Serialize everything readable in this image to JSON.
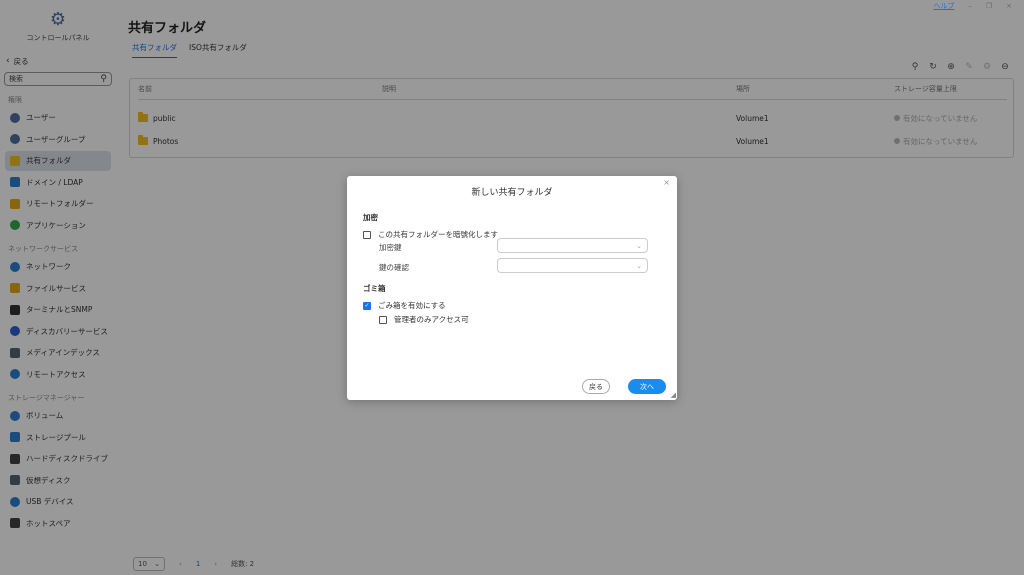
{
  "window": {
    "help": "ヘルプ",
    "minimize": "–",
    "restore": "❐",
    "close": "×"
  },
  "sidebar": {
    "title": "コントロールパネル",
    "back": "戻る",
    "search_placeholder": "検索",
    "sections": [
      {
        "label": "権限",
        "items": [
          {
            "label": "ユーザー",
            "icon": "user-icon",
            "color": "#4d6fa3"
          },
          {
            "label": "ユーザーグループ",
            "icon": "user-group-icon",
            "color": "#4d6fa3"
          },
          {
            "label": "共有フォルダ",
            "icon": "folder-icon",
            "color": "#f0c020",
            "active": true
          },
          {
            "label": "ドメイン / LDAP",
            "icon": "domain-icon",
            "color": "#2d7fd3"
          },
          {
            "label": "リモートフォルダー",
            "icon": "remote-folder-icon",
            "color": "#e6a817"
          },
          {
            "label": "アプリケーション",
            "icon": "application-icon",
            "color": "#34a853"
          }
        ]
      },
      {
        "label": "ネットワークサービス",
        "items": [
          {
            "label": "ネットワーク",
            "icon": "network-icon",
            "color": "#2d7fd3"
          },
          {
            "label": "ファイルサービス",
            "icon": "file-service-icon",
            "color": "#e6a817"
          },
          {
            "label": "ターミナルとSNMP",
            "icon": "terminal-icon",
            "color": "#333333"
          },
          {
            "label": "ディスカバリーサービス",
            "icon": "discovery-icon",
            "color": "#2d5fd3"
          },
          {
            "label": "メディアインデックス",
            "icon": "media-index-icon",
            "color": "#556677"
          },
          {
            "label": "リモートアクセス",
            "icon": "remote-access-icon",
            "color": "#2d7fd3"
          }
        ]
      },
      {
        "label": "ストレージマネージャー",
        "items": [
          {
            "label": "ボリューム",
            "icon": "volume-icon",
            "color": "#2d7fd3"
          },
          {
            "label": "ストレージプール",
            "icon": "storage-pool-icon",
            "color": "#2d7fd3"
          },
          {
            "label": "ハードディスクドライブ",
            "icon": "hdd-icon",
            "color": "#444444"
          },
          {
            "label": "仮想ディスク",
            "icon": "virtual-disk-icon",
            "color": "#556677"
          },
          {
            "label": "USB デバイス",
            "icon": "usb-icon",
            "color": "#2d7fd3"
          },
          {
            "label": "ホットスペア",
            "icon": "hot-spare-icon",
            "color": "#444444"
          }
        ]
      }
    ]
  },
  "main": {
    "title": "共有フォルダ",
    "tabs": [
      {
        "label": "共有フォルダ",
        "active": true
      },
      {
        "label": "ISO共有フォルダ",
        "active": false
      }
    ],
    "toolbar": {
      "search": "⚲",
      "refresh": "↻",
      "add": "⊕",
      "edit": "✎",
      "settings": "⚙",
      "remove": "⊖"
    },
    "table": {
      "headers": {
        "name": "名前",
        "desc": "説明",
        "location": "場所",
        "quota": "ストレージ容量上限"
      },
      "rows": [
        {
          "name": "public",
          "desc": "",
          "location": "Volume1",
          "quota": "有効になっていません"
        },
        {
          "name": "Photos",
          "desc": "",
          "location": "Volume1",
          "quota": "有効になっていません"
        }
      ]
    },
    "pager": {
      "page_size": "10",
      "prev": "‹",
      "page": "1",
      "next": "›",
      "total": "総数: 2"
    }
  },
  "dialog": {
    "title": "新しい共有フォルダ",
    "close": "×",
    "encryption": {
      "section": "加密",
      "checkbox": "この共有フォルダーを暗號化します",
      "key_label": "加密鍵",
      "confirm_label": "鍵の確認"
    },
    "recycle": {
      "section": "ゴミ箱",
      "enable": "ごみ箱を有効にする",
      "admin_only": "管理者のみアクセス可"
    },
    "buttons": {
      "back": "戻る",
      "next": "次へ"
    }
  }
}
